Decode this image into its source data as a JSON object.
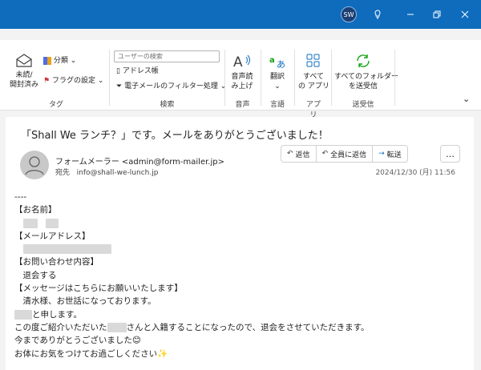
{
  "titlebar": {
    "user_initials": "SW"
  },
  "ribbon": {
    "read_unread": "未読/\n開封済み",
    "categorize": "分類",
    "flag": "フラグの設定",
    "tags_label": "タグ",
    "search_placeholder": "ユーザーの検索",
    "address_book": "アドレス帳",
    "filter_email": "電子メールのフィルター処理",
    "search_label": "検索",
    "read_aloud": "音声読\nみ上げ",
    "speech_label": "音声",
    "translate": "翻訳",
    "language_label": "言語",
    "all_apps": "すべて\nの アプリ",
    "apps_label": "アプリ",
    "send_receive_all": "すべてのフォルダー\nを送受信",
    "send_receive_label": "送受信"
  },
  "message": {
    "subject": "「Shall We ランチ？」です。メールをありがとうございました！",
    "sender": "フォームメーラー <admin@form-mailer.jp>",
    "to_label": "宛先",
    "to_address": "info@shall-we-lunch.jp",
    "date": "2024/12/30 (月) 11:56",
    "reply": "返信",
    "reply_all": "全員に返信",
    "forward": "転送",
    "more": "…",
    "body": {
      "line_divider": "----",
      "name_header": "【お名前】",
      "email_header": "【メールアドレス】",
      "inquiry_header": "【お問い合わせ内容】",
      "inquiry_value": "　退会する",
      "message_header": "【メッセージはこちらにお願いいたします】",
      "line1": "　清水様、お世話になっております。",
      "line2_suffix": "と申します。",
      "line3_prefix": "この度ご紹介いただいた",
      "line3_suffix": "さんと入籍することになったので、退会をさせていただきます。",
      "line4": "今までありがとうございました😊",
      "line5": "お体にお気をつけてお過ごしください✨"
    }
  },
  "colors": {
    "titlebar": "#0f6cbd",
    "accent": "#0f6cbd",
    "refresh_green": "#13a10e"
  }
}
